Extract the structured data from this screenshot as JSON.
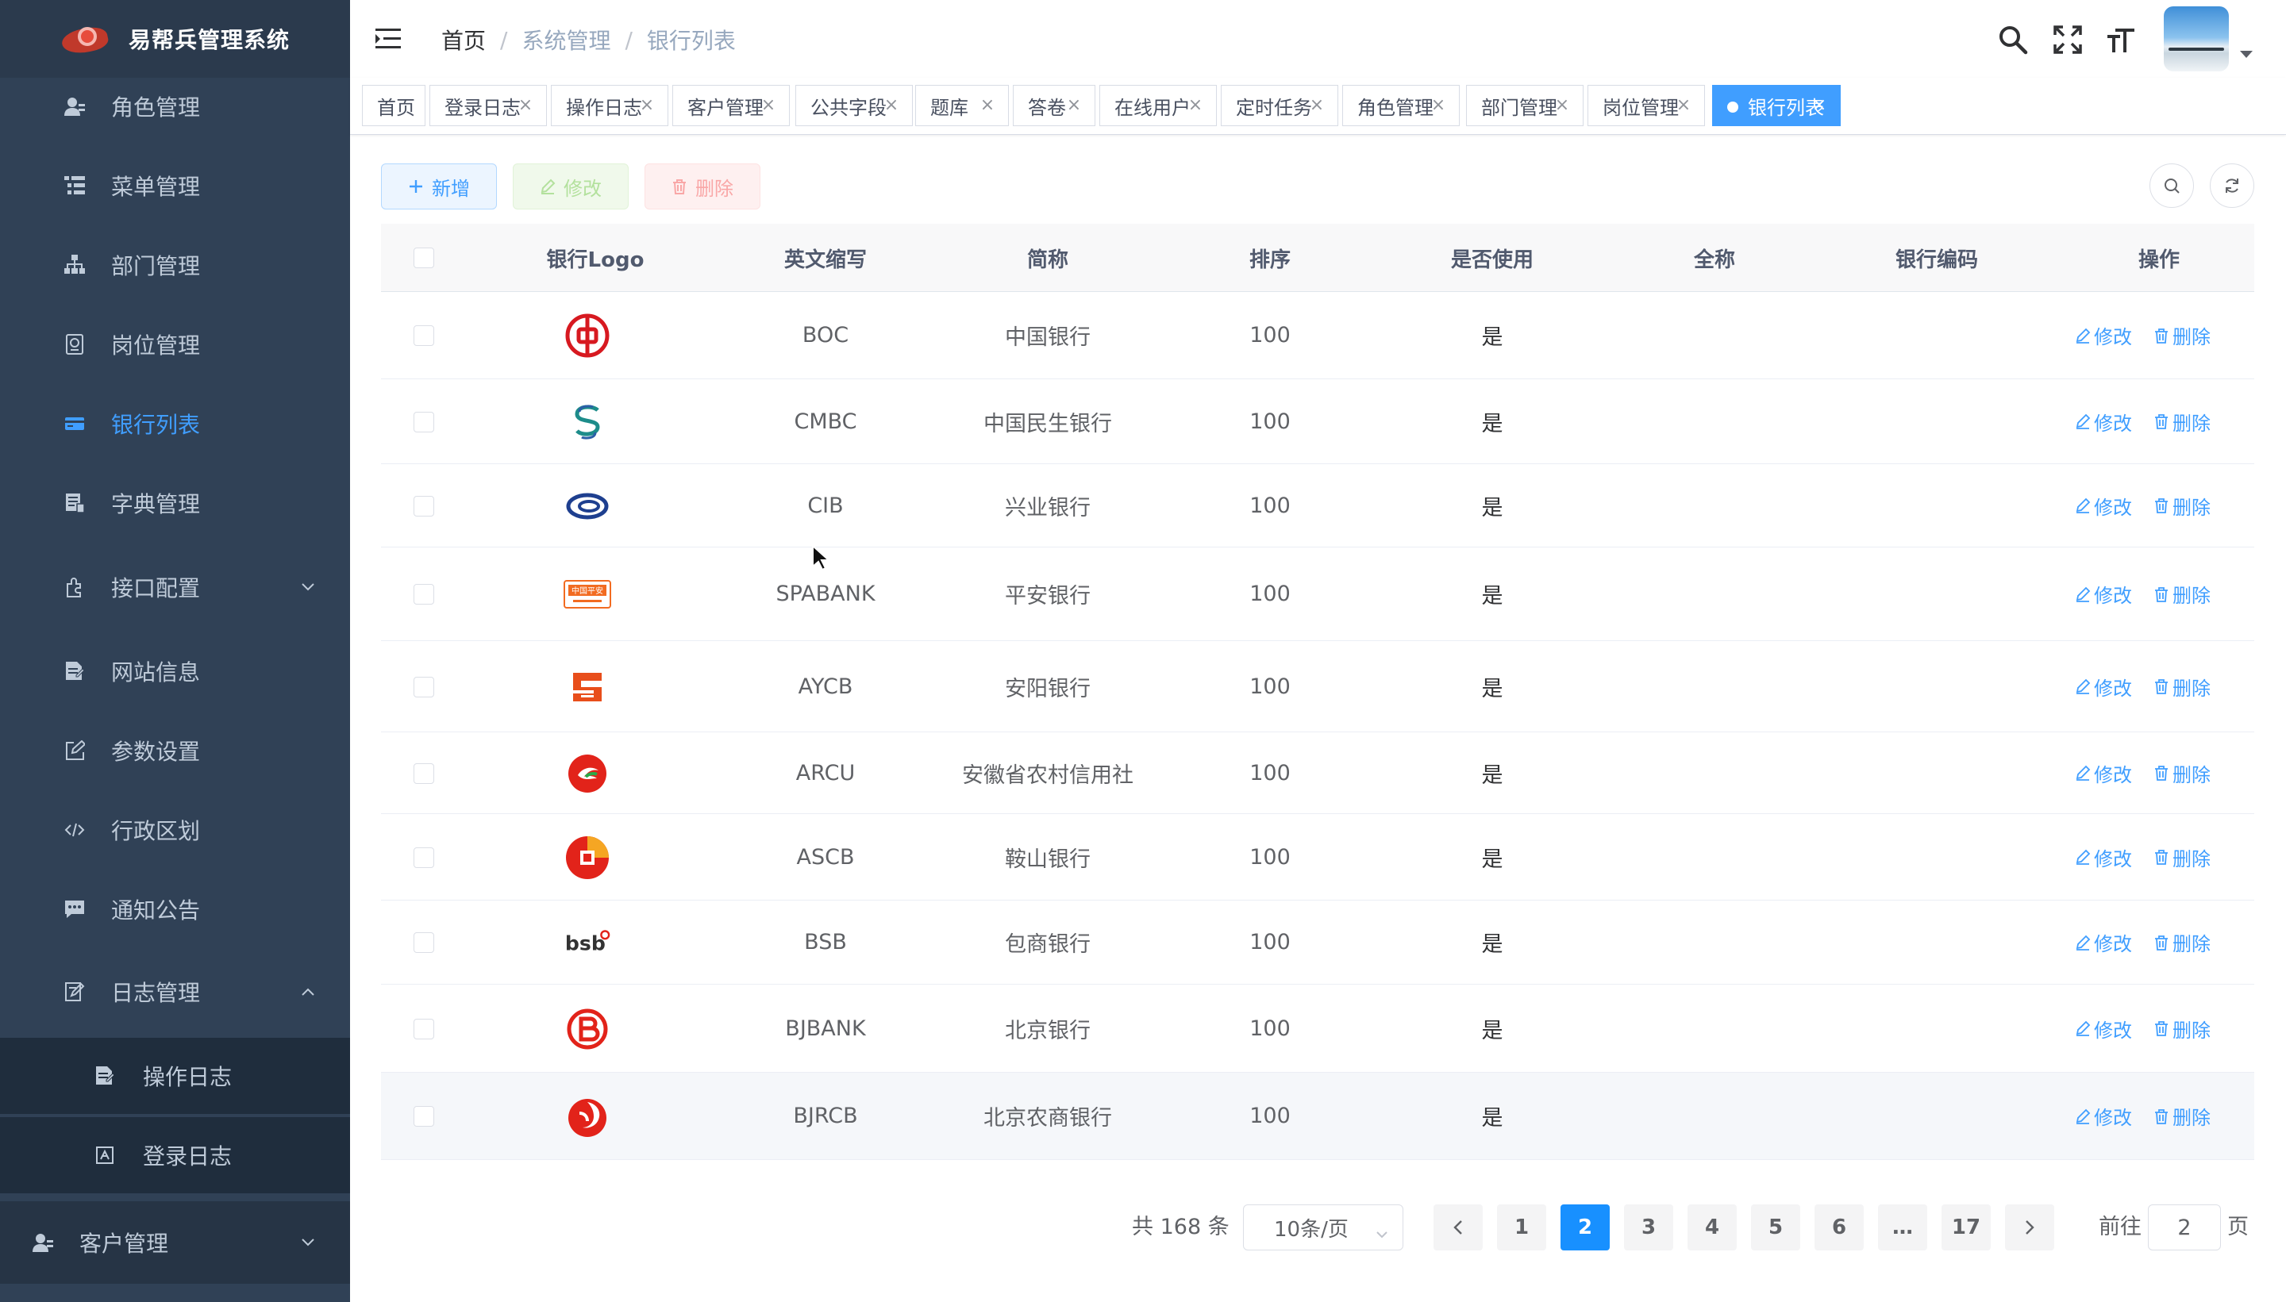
{
  "app": {
    "title": "易帮兵管理系统"
  },
  "sidebar": {
    "items": [
      {
        "label": "角色管理",
        "icon": "user-role-icon"
      },
      {
        "label": "菜单管理",
        "icon": "menu-tree-icon"
      },
      {
        "label": "部门管理",
        "icon": "org-tree-icon"
      },
      {
        "label": "岗位管理",
        "icon": "post-icon"
      },
      {
        "label": "银行列表",
        "icon": "bank-card-icon",
        "active": true
      },
      {
        "label": "字典管理",
        "icon": "dictionary-icon"
      },
      {
        "label": "接口配置",
        "icon": "plugin-icon",
        "expandable": true
      },
      {
        "label": "网站信息",
        "icon": "document-icon"
      },
      {
        "label": "参数设置",
        "icon": "edit-icon"
      },
      {
        "label": "行政区划",
        "icon": "code-icon"
      },
      {
        "label": "通知公告",
        "icon": "message-icon"
      },
      {
        "label": "日志管理",
        "icon": "log-icon",
        "expanded": true
      }
    ],
    "subitems": [
      {
        "label": "操作日志",
        "icon": "form-icon"
      },
      {
        "label": "登录日志",
        "icon": "login-log-icon"
      }
    ],
    "customer": {
      "label": "客户管理",
      "icon": "customer-icon"
    }
  },
  "navbar": {
    "breadcrumb": [
      "首页",
      "系统管理",
      "银行列表"
    ],
    "breadcrumb_sep": "/"
  },
  "tags": [
    {
      "label": "首页",
      "closable": false
    },
    {
      "label": "登录日志",
      "closable": true
    },
    {
      "label": "操作日志",
      "closable": true
    },
    {
      "label": "客户管理",
      "closable": true
    },
    {
      "label": "公共字段",
      "closable": true
    },
    {
      "label": "题库",
      "closable": true
    },
    {
      "label": "答卷",
      "closable": true
    },
    {
      "label": "在线用户",
      "closable": true
    },
    {
      "label": "定时任务",
      "closable": true
    },
    {
      "label": "角色管理",
      "closable": true
    },
    {
      "label": "部门管理",
      "closable": true
    },
    {
      "label": "岗位管理",
      "closable": true
    },
    {
      "label": "银行列表",
      "closable": true,
      "active": true
    }
  ],
  "tag_close_glyph": "×",
  "toolbar": {
    "add_label": "新增",
    "edit_label": "修改",
    "delete_label": "删除"
  },
  "table": {
    "columns": [
      "银行Logo",
      "英文缩写",
      "简称",
      "排序",
      "是否使用",
      "全称",
      "银行编码",
      "操作"
    ],
    "rows": [
      {
        "logo": "boc",
        "abbr": "BOC",
        "name": "中国银行",
        "sort": "100",
        "used": "是",
        "fullname": "",
        "code": ""
      },
      {
        "logo": "cmbc",
        "abbr": "CMBC",
        "name": "中国民生银行",
        "sort": "100",
        "used": "是",
        "fullname": "",
        "code": ""
      },
      {
        "logo": "cib",
        "abbr": "CIB",
        "name": "兴业银行",
        "sort": "100",
        "used": "是",
        "fullname": "",
        "code": ""
      },
      {
        "logo": "spabank",
        "abbr": "SPABANK",
        "name": "平安银行",
        "sort": "100",
        "used": "是",
        "fullname": "",
        "code": ""
      },
      {
        "logo": "aycb",
        "abbr": "AYCB",
        "name": "安阳银行",
        "sort": "100",
        "used": "是",
        "fullname": "",
        "code": ""
      },
      {
        "logo": "arcu",
        "abbr": "ARCU",
        "name": "安徽省农村信用社",
        "sort": "100",
        "used": "是",
        "fullname": "",
        "code": ""
      },
      {
        "logo": "ascb",
        "abbr": "ASCB",
        "name": "鞍山银行",
        "sort": "100",
        "used": "是",
        "fullname": "",
        "code": ""
      },
      {
        "logo": "bsb",
        "abbr": "BSB",
        "name": "包商银行",
        "sort": "100",
        "used": "是",
        "fullname": "",
        "code": ""
      },
      {
        "logo": "bjbank",
        "abbr": "BJBANK",
        "name": "北京银行",
        "sort": "100",
        "used": "是",
        "fullname": "",
        "code": ""
      },
      {
        "logo": "bjrcb",
        "abbr": "BJRCB",
        "name": "北京农商银行",
        "sort": "100",
        "used": "是",
        "fullname": "",
        "code": ""
      }
    ],
    "op_edit": "修改",
    "op_delete": "删除"
  },
  "logo_text": {
    "spabank": "中国平安",
    "bsb": "bsb"
  },
  "pagination": {
    "total_text": "共 168 条",
    "page_size": "10条/页",
    "pages": [
      "1",
      "2",
      "3",
      "4",
      "5",
      "6",
      "…",
      "17"
    ],
    "current": "2",
    "jump_prefix": "前往",
    "jump_value": "2",
    "jump_suffix": "页"
  },
  "colors": {
    "sidebar_bg": "#304156",
    "accent": "#409eff",
    "pagination_active": "#1890ff"
  }
}
